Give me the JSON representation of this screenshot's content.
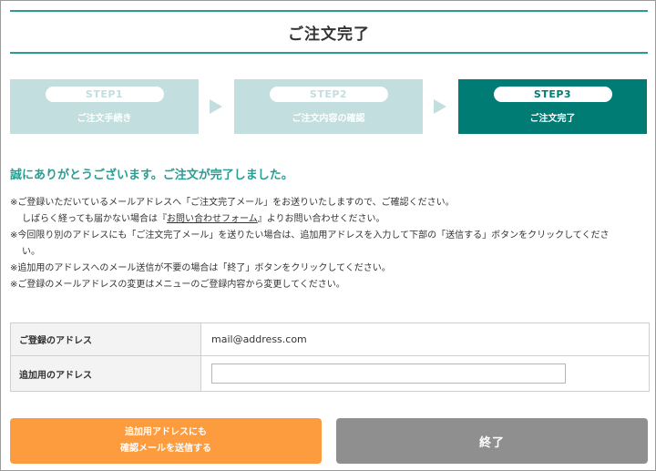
{
  "page": {
    "title": "ご注文完了"
  },
  "steps": [
    {
      "step": "STEP1",
      "label": "ご注文手続き",
      "active": false
    },
    {
      "step": "STEP2",
      "label": "ご注文内容の確認",
      "active": false
    },
    {
      "step": "STEP3",
      "label": "ご注文完了",
      "active": true
    }
  ],
  "message": {
    "thanks": "誠にありがとうございます。ご注文が完了しました。",
    "note1": "※ご登録いただいているメールアドレスへ「ご注文完了メール」をお送りいたしますので、ご確認ください。",
    "note2_before": "しばらく経っても届かない場合は『",
    "note2_link": "お問い合わせフォーム",
    "note2_after": "』よりお問い合わせください。",
    "note3a": "※今回限り別のアドレスにも「ご注文完了メール」を送りたい場合は、追加用アドレスを入力して下部の「送信する」ボタンをクリックしてくださ",
    "note3b": "い。",
    "note4": "※追加用のアドレスへのメール送信が不要の場合は「終了」ボタンをクリックしてください。",
    "note5": "※ご登録のメールアドレスの変更はメニューのご登録内容から変更してください。"
  },
  "addresses": {
    "registered_label": "ご登録のアドレス",
    "registered_value": "mail@address.com",
    "additional_label": "追加用のアドレス",
    "additional_value": ""
  },
  "buttons": {
    "send_line1": "追加用アドレスにも",
    "send_line2": "確認メールを送信する",
    "end_label": "終了"
  },
  "colors": {
    "accent": "#2a9d93",
    "step_active": "#017c74",
    "step_inactive": "#c2dede",
    "send_button": "#fd9b3f",
    "end_button": "#8f8f8f"
  }
}
